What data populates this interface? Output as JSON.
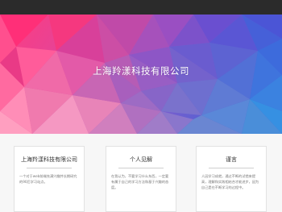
{
  "hero": {
    "title": "上海羚漾科技有限公司"
  },
  "cards": [
    {
      "title": "上海羚漾科技有限公司",
      "text": "一个对于web前端充满兴趣并长期研究的90后学习站点。"
    },
    {
      "title": "个人见解",
      "text": "在我认为，不要学习什么东西，一定要有属于自己的学习方法和基于兴趣的态度。"
    },
    {
      "title": "谨言",
      "text": "人因学习成就，通过不断的试错来提高，理解和实践相结合才能进步，因为自己是在不断学习的过程中。"
    }
  ],
  "colors": {
    "topbar": "#2b2b2b",
    "page_bg": "#f7f7f7",
    "card_border": "#e2e2e2",
    "hero_pink": "#ff2f8c",
    "hero_purple": "#8a5cd0",
    "hero_blue": "#3a5fd8"
  }
}
